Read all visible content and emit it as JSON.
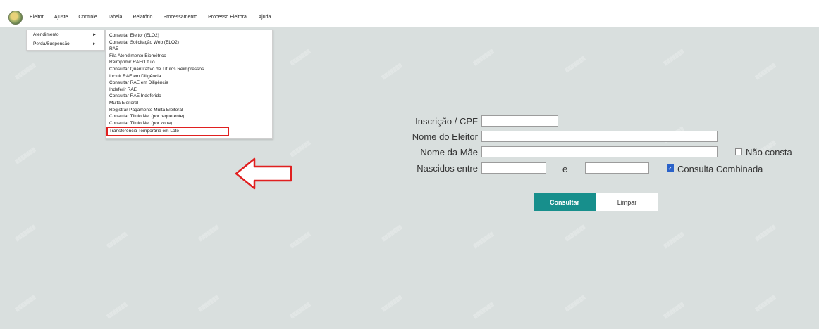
{
  "menubar": {
    "items": [
      "Eleitor",
      "Ajuste",
      "Controle",
      "Tabela",
      "Relatório",
      "Processamento",
      "Processo Eleitoral",
      "Ajuda"
    ]
  },
  "submenu_eleitor": {
    "items": [
      {
        "label": "Atendimento",
        "arrow": "►"
      },
      {
        "label": "Perda/Suspensão",
        "arrow": "►"
      }
    ]
  },
  "submenu_atendimento": {
    "items": [
      "Consultar Eleitor (ELO2)",
      "Consultar Solicitação Web (ELO2)",
      "RAE",
      "Fila Atendimento Biométrico",
      "Reimprimir RAE/Título",
      "Consultar Quantitativo de Títulos Reimpressos",
      "Incluir RAE em Diligência",
      "Consultar RAE em Diligência",
      "Indeferir RAE",
      "Consultar RAE Indeferido",
      "Multa Eleitoral",
      "Registrar Pagamento Multa Eleitoral",
      "Consultar Título Net (por requerente)",
      "Consultar Título Net (por zona)",
      "Transferência Temporária em Lote"
    ]
  },
  "form": {
    "inscricao_label": "Inscrição / CPF",
    "nome_eleitor_label": "Nome do Eleitor",
    "nome_mae_label": "Nome da Mãe",
    "nao_consta_label": "Não consta",
    "nascidos_label": "Nascidos entre",
    "e_label": "e",
    "consulta_combinada_label": "Consulta Combinada",
    "consulta_combinada_checked": true,
    "nao_consta_checked": false,
    "consultar_label": "Consultar",
    "limpar_label": "Limpar"
  },
  "colors": {
    "primary_button": "#178f8c",
    "highlight_border": "#e02020",
    "background": "#d9dfde"
  }
}
